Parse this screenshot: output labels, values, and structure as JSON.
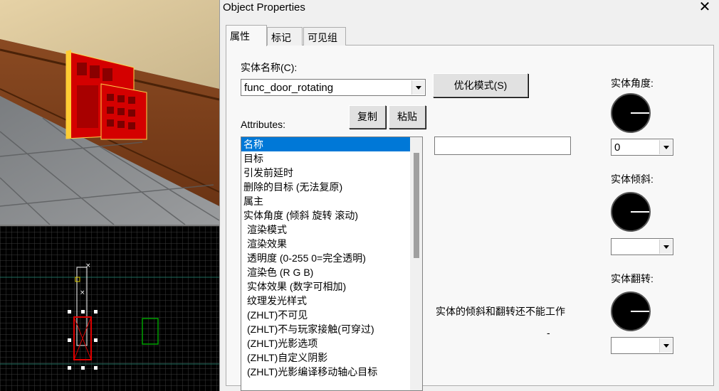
{
  "dialog": {
    "title": "Object Properties",
    "close_glyph": "✕",
    "tabs": [
      {
        "label": "属性",
        "active": true
      },
      {
        "label": "标记",
        "active": false
      },
      {
        "label": "可见组",
        "active": false
      }
    ],
    "entity_name_label": "实体名称(C):",
    "entity_name_value": "func_door_rotating",
    "smart_edit_button": "优化模式(S)",
    "attributes_label": "Attributes:",
    "copy_button": "复制",
    "paste_button": "粘贴",
    "value_field": "",
    "attributes": [
      {
        "label": "名称",
        "selected": true,
        "indent": false
      },
      {
        "label": "目标",
        "selected": false,
        "indent": false
      },
      {
        "label": "引发前延时",
        "selected": false,
        "indent": false
      },
      {
        "label": "删除的目标 (无法复原)",
        "selected": false,
        "indent": false
      },
      {
        "label": "属主",
        "selected": false,
        "indent": false
      },
      {
        "label": "实体角度 (倾斜 旋转 滚动)",
        "selected": false,
        "indent": false
      },
      {
        "label": "渲染模式",
        "selected": false,
        "indent": true
      },
      {
        "label": "渲染效果",
        "selected": false,
        "indent": true
      },
      {
        "label": "透明度 (0-255 0=完全透明)",
        "selected": false,
        "indent": true
      },
      {
        "label": "渲染色 (R G B)",
        "selected": false,
        "indent": true
      },
      {
        "label": "实体效果 (数字可相加)",
        "selected": false,
        "indent": true
      },
      {
        "label": "纹理发光样式",
        "selected": false,
        "indent": true
      },
      {
        "label": "(ZHLT)不可见",
        "selected": false,
        "indent": true
      },
      {
        "label": "(ZHLT)不与玩家接触(可穿过)",
        "selected": false,
        "indent": true
      },
      {
        "label": "(ZHLT)光影选项",
        "selected": false,
        "indent": true
      },
      {
        "label": "(ZHLT)自定义阴影",
        "selected": false,
        "indent": true
      },
      {
        "label": "(ZHLT)光影编译移动轴心目标",
        "selected": false,
        "indent": true
      }
    ],
    "help_text": "实体的倾斜和翻转还不能工作",
    "dash": "-",
    "angle_label": "实体角度:",
    "angle_value": "0",
    "pitch_label": "实体倾斜:",
    "pitch_value": "",
    "roll_label": "实体翻转:",
    "roll_value": ""
  },
  "colors": {
    "selection": "#0078d7",
    "door_red": "#d40000",
    "grid_line": "#3a3a3a",
    "axis_green": "#00a000"
  }
}
